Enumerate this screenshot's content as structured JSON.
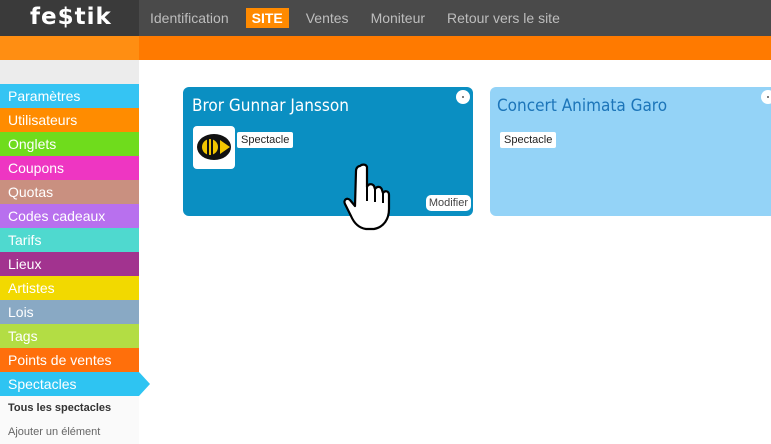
{
  "app": {
    "logo": "fe$tik"
  },
  "nav": [
    {
      "label": "Identification",
      "active": false
    },
    {
      "label": "SITE",
      "active": true
    },
    {
      "label": "Ventes",
      "active": false
    },
    {
      "label": "Moniteur",
      "active": false
    },
    {
      "label": "Retour vers le site",
      "active": false
    }
  ],
  "colors": {
    "topbar": "#4a4a4a",
    "accent": "#ff7a00",
    "card_active": "#0a8fc2",
    "card_inactive": "#94d3f7"
  },
  "sidebar": {
    "items": [
      {
        "label": "Paramètres",
        "color": "#35c4f3"
      },
      {
        "label": "Utilisateurs",
        "color": "#ff8c00"
      },
      {
        "label": "Onglets",
        "color": "#6fdc1c"
      },
      {
        "label": "Coupons",
        "color": "#ee36c2"
      },
      {
        "label": "Quotas",
        "color": "#c99080"
      },
      {
        "label": "Codes cadeaux",
        "color": "#b870ee"
      },
      {
        "label": "Tarifs",
        "color": "#4fd9cf"
      },
      {
        "label": "Lieux",
        "color": "#a2338f"
      },
      {
        "label": "Artistes",
        "color": "#f2d900"
      },
      {
        "label": "Lois",
        "color": "#89a9c4"
      },
      {
        "label": "Tags",
        "color": "#b3dd44"
      },
      {
        "label": "Points de ventes",
        "color": "#ff6f0b"
      },
      {
        "label": "Spectacles",
        "color": "#2ec4f2",
        "selected": true
      }
    ],
    "sub_all": "Tous les spectacles",
    "sub_add": "Ajouter un élément"
  },
  "cards": [
    {
      "title": "Bror Gunnar Jansson",
      "tag": "Spectacle",
      "action": "Modifier"
    },
    {
      "title": "Concert Animata Garo",
      "tag": "Spectacle"
    }
  ]
}
